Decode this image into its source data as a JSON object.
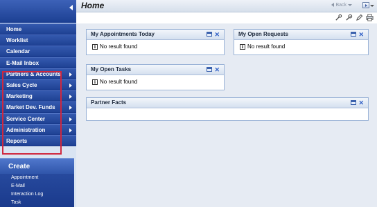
{
  "header": {
    "title": "Home",
    "back_label": "Back"
  },
  "nav": {
    "items": [
      {
        "label": "Home",
        "submenu": false
      },
      {
        "label": "Worklist",
        "submenu": false
      },
      {
        "label": "Calendar",
        "submenu": false
      },
      {
        "label": "E-Mail Inbox",
        "submenu": false
      },
      {
        "label": "Partners & Accounts",
        "submenu": true
      },
      {
        "label": "Sales Cycle",
        "submenu": true
      },
      {
        "label": "Marketing",
        "submenu": true
      },
      {
        "label": "Market Dev. Funds",
        "submenu": true
      },
      {
        "label": "Service Center",
        "submenu": true
      },
      {
        "label": "Administration",
        "submenu": true
      },
      {
        "label": "Reports",
        "submenu": false
      }
    ]
  },
  "create": {
    "title": "Create",
    "links": [
      "Appointment",
      "E-Mail",
      "Interaction Log",
      "Task"
    ]
  },
  "toolbar": {
    "icons": [
      "personalize-icon",
      "settings-icon",
      "edit-icon",
      "print-icon"
    ]
  },
  "panels": {
    "appointments": {
      "title": "My Appointments Today",
      "message": "No result found"
    },
    "requests": {
      "title": "My Open Requests",
      "message": "No result found"
    },
    "tasks": {
      "title": "My Open Tasks",
      "message": "No result found"
    },
    "partner_facts": {
      "title": "Partner Facts"
    }
  },
  "colors": {
    "nav_bg": "#2a4ea3",
    "highlight": "#d0273e",
    "panel_border": "#99b2d6",
    "main_bg": "#e6ebf3"
  }
}
